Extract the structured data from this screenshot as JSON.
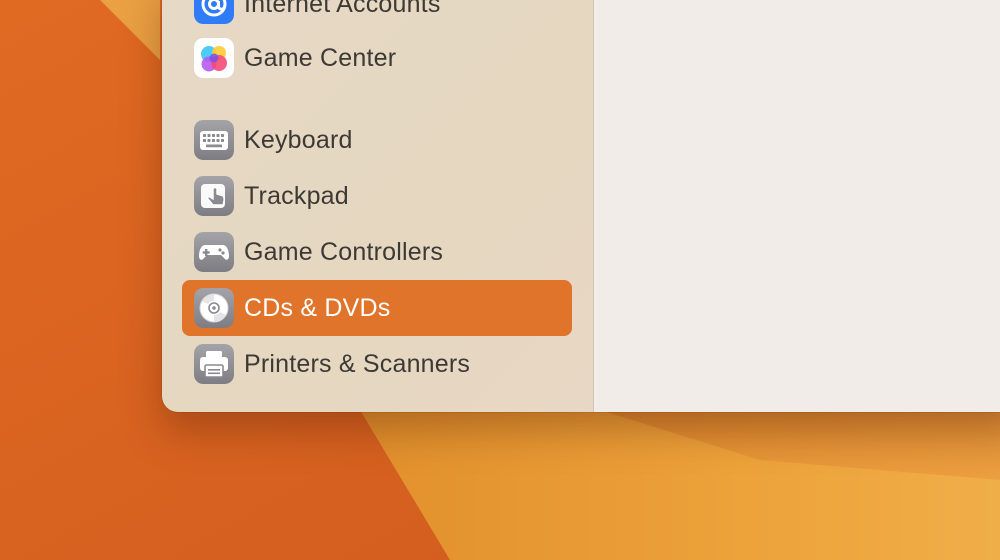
{
  "sidebar": {
    "items": [
      {
        "label": "Internet Accounts",
        "icon": "at-sign-icon",
        "selected": false
      },
      {
        "label": "Game Center",
        "icon": "game-center-icon",
        "selected": false
      },
      {
        "label": "Keyboard",
        "icon": "keyboard-icon",
        "selected": false
      },
      {
        "label": "Trackpad",
        "icon": "trackpad-icon",
        "selected": false
      },
      {
        "label": "Game Controllers",
        "icon": "game-controller-icon",
        "selected": false
      },
      {
        "label": "CDs & DVDs",
        "icon": "disc-icon",
        "selected": true
      },
      {
        "label": "Printers & Scanners",
        "icon": "printer-icon",
        "selected": false
      }
    ]
  },
  "colors": {
    "selection": "#e0742a",
    "sidebar_bg": "#e6d9c6",
    "content_bg": "#f1ece7",
    "wallpaper_dark": "#d9682a",
    "wallpaper_light": "#f0a13a"
  }
}
